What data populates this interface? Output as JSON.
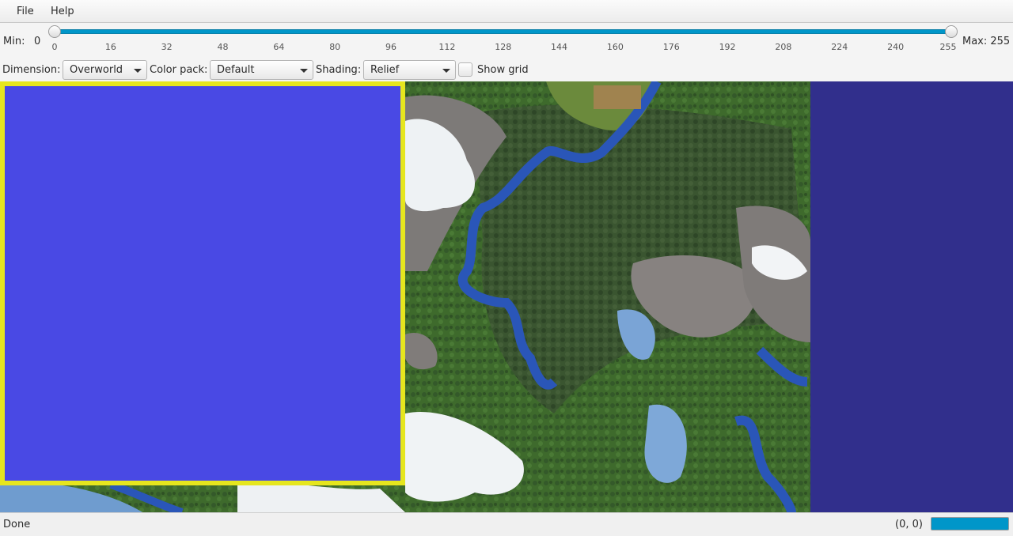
{
  "menu": {
    "file": "File",
    "help": "Help"
  },
  "slider": {
    "min_label": "Min:",
    "min_value": "0",
    "max_label": "Max: 255",
    "ticks": [
      "0",
      "16",
      "32",
      "48",
      "64",
      "80",
      "96",
      "112",
      "128",
      "144",
      "160",
      "176",
      "192",
      "208",
      "224",
      "240",
      "255"
    ],
    "range": {
      "low": 0,
      "high": 255
    }
  },
  "controls": {
    "dimension_label": "Dimension:",
    "dimension_value": "Overworld",
    "colorpack_label": "Color pack:",
    "colorpack_value": "Default",
    "shading_label": "Shading:",
    "shading_value": "Relief",
    "showgrid_label": "Show grid",
    "showgrid_checked": false
  },
  "map": {
    "selection_color": "#4949e4",
    "selection_border": "#e6e61e",
    "void_color": "#312f8c"
  },
  "status": {
    "text": "Done",
    "coords": "(0, 0)",
    "progress": 1.0
  },
  "colors": {
    "accent": "#0096c9"
  }
}
